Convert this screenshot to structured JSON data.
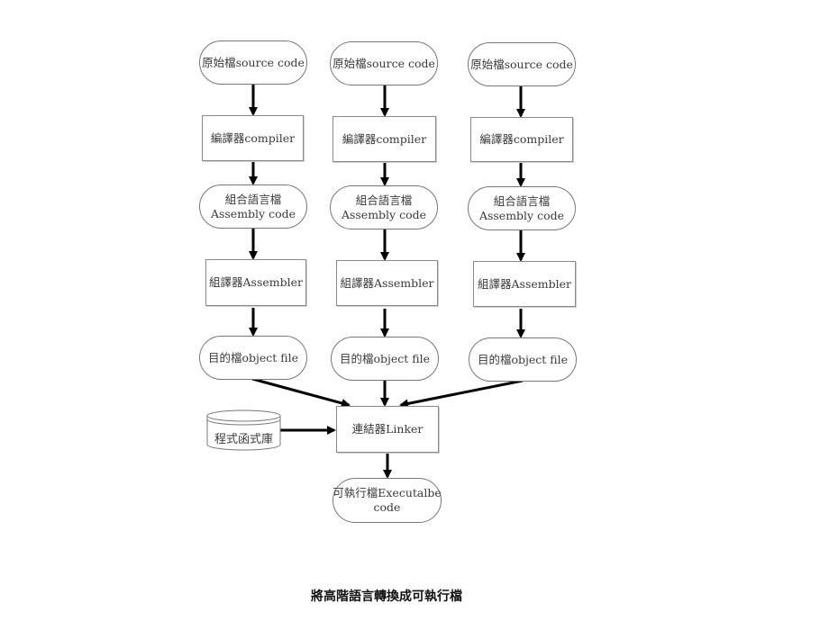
{
  "columns": [
    {
      "source": "原始檔source code",
      "compiler": "編譯器compiler",
      "assembly_line1": "組合語言檔",
      "assembly_line2": "Assembly code",
      "assembler": "組譯器Assembler",
      "object": "目的檔object file"
    },
    {
      "source": "原始檔source code",
      "compiler": "編譯器compiler",
      "assembly_line1": "組合語言檔",
      "assembly_line2": "Assembly code",
      "assembler": "組譯器Assembler",
      "object": "目的檔object file"
    },
    {
      "source": "原始檔source code",
      "compiler": "編譯器compiler",
      "assembly_line1": "組合語言檔",
      "assembly_line2": "Assembly code",
      "assembler": "組譯器Assembler",
      "object": "目的檔object file"
    }
  ],
  "library": "程式函式庫",
  "linker": "連結器Linker",
  "executable_line1": "可執行檔Executalbe",
  "executable_line2": "code",
  "caption": "將高階語言轉換成可執行檔",
  "colors": {
    "arrow": "#000000",
    "node_border": "#777777",
    "text": "#3a3a3a"
  }
}
